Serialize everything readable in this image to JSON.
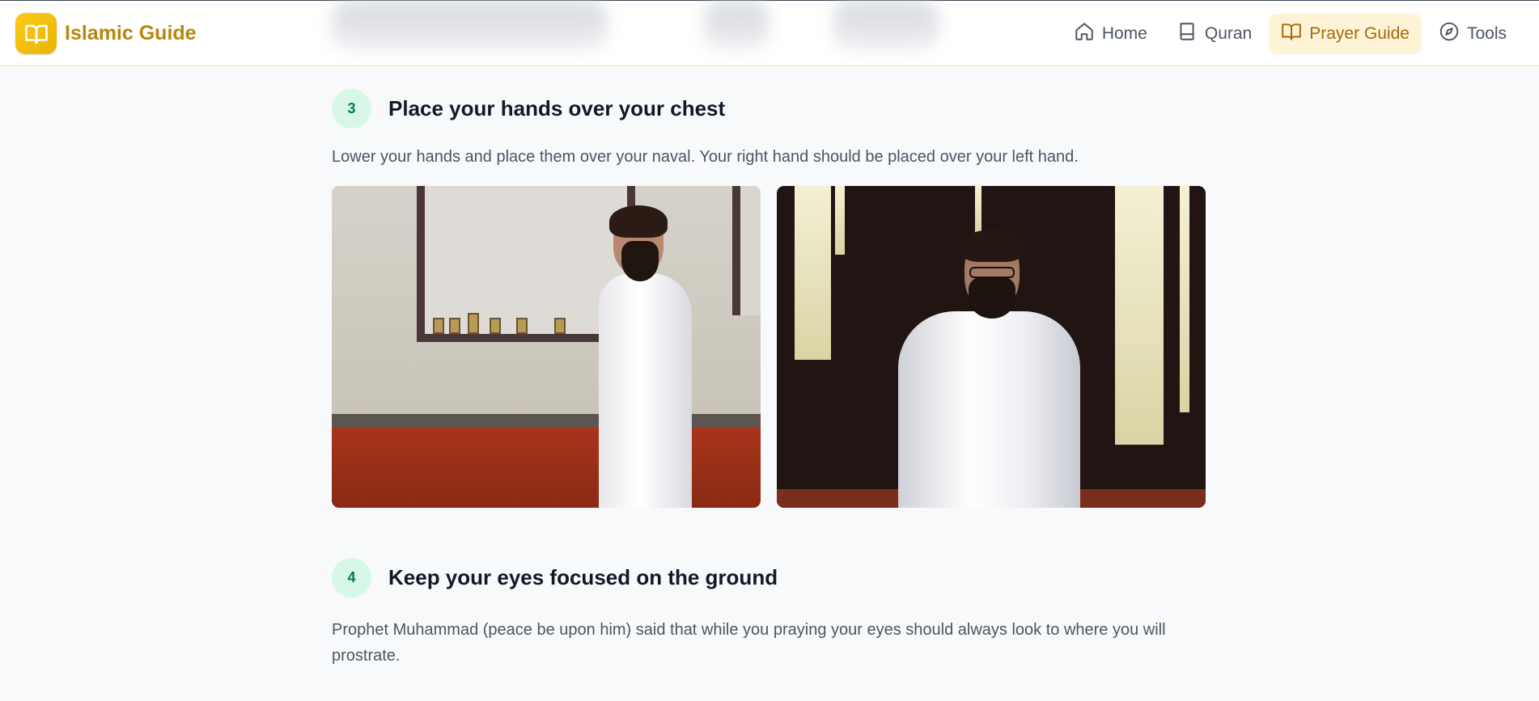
{
  "brand": {
    "name": "Islamic Guide",
    "logo_icon": "open-book-icon"
  },
  "nav": {
    "items": [
      {
        "label": "Home",
        "icon": "home-icon",
        "active": false
      },
      {
        "label": "Quran",
        "icon": "book-icon",
        "active": false
      },
      {
        "label": "Prayer Guide",
        "icon": "open-book-icon",
        "active": true
      },
      {
        "label": "Tools",
        "icon": "compass-icon",
        "active": false
      }
    ]
  },
  "steps": [
    {
      "number": "3",
      "title": "Place your hands over your chest",
      "description": "Lower your hands and place them over your naval. Your right hand should be placed over your left hand."
    },
    {
      "number": "4",
      "title": "Keep your eyes focused on the ground",
      "description": "Prophet Muhammad (peace be upon him) said that while you praying your eyes should always look to where you will prostrate."
    }
  ],
  "colors": {
    "accent": "#eab308",
    "brand_text": "#b8860b",
    "active_nav_bg": "#fef3d6",
    "step_badge_bg": "#d8f8e7",
    "step_badge_text": "#047857"
  }
}
